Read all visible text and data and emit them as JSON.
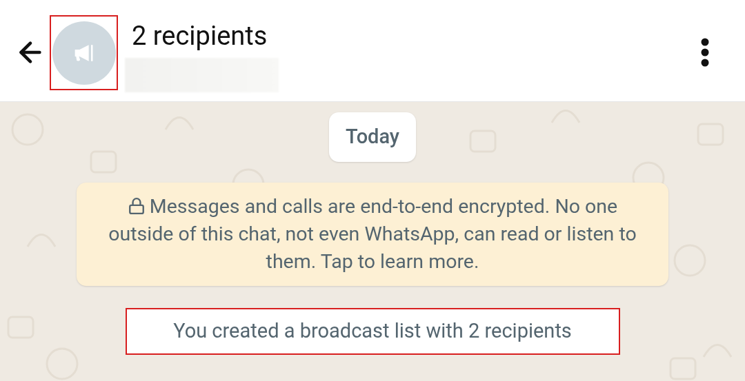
{
  "header": {
    "title": "2 recipients",
    "avatar": {
      "highlighted": true
    }
  },
  "chat": {
    "date_chip": "Today",
    "encryption_notice": "Messages and calls are end-to-end encrypted. No one outside of this chat, not even WhatsApp, can read or listen to them. Tap to learn more.",
    "system_message": {
      "text": "You created a broadcast list with 2 recipients",
      "highlighted": true
    }
  }
}
